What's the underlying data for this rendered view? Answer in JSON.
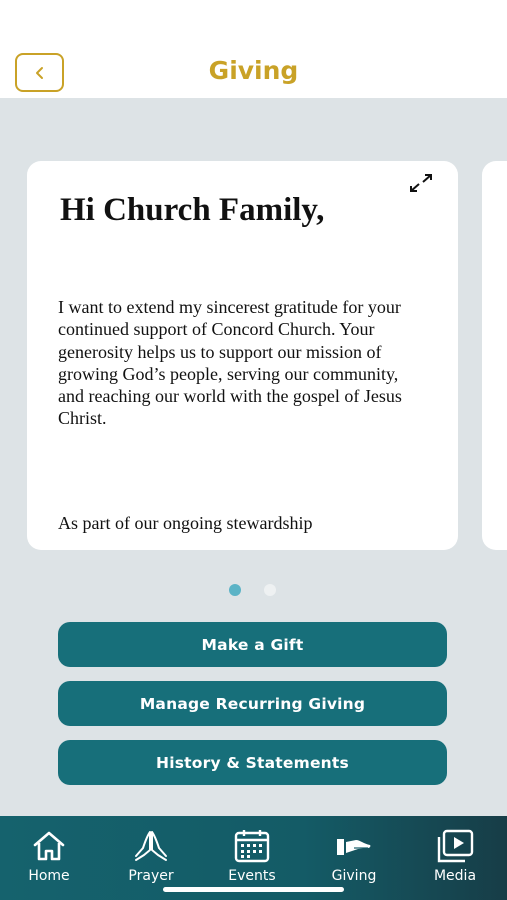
{
  "header": {
    "title": "Giving",
    "back_icon": "chevron-left-icon",
    "accent_color": "#c9a227"
  },
  "card": {
    "heading": "Hi Church Family,",
    "body": "I want to extend my sincerest gratitude for your continued support of Concord Church. Your generosity helps us to support our mission of growing God’s people, serving our community, and reaching our world with the gospel of Jesus Christ.",
    "body_continued": "As part of our ongoing stewardship",
    "expand_icon": "expand-icon"
  },
  "pagination": {
    "current_page": 1,
    "total_pages": 2
  },
  "actions": {
    "make_gift": "Make a Gift",
    "manage_recurring": "Manage Recurring Giving",
    "history": "History & Statements",
    "button_color": "#176f7a"
  },
  "nav": {
    "items": [
      {
        "label": "Home",
        "icon": "home-icon"
      },
      {
        "label": "Prayer",
        "icon": "praying-hands-icon"
      },
      {
        "label": "Events",
        "icon": "calendar-icon"
      },
      {
        "label": "Giving",
        "icon": "giving-hand-icon"
      },
      {
        "label": "Media",
        "icon": "play-media-icon"
      }
    ],
    "active": "Giving"
  }
}
